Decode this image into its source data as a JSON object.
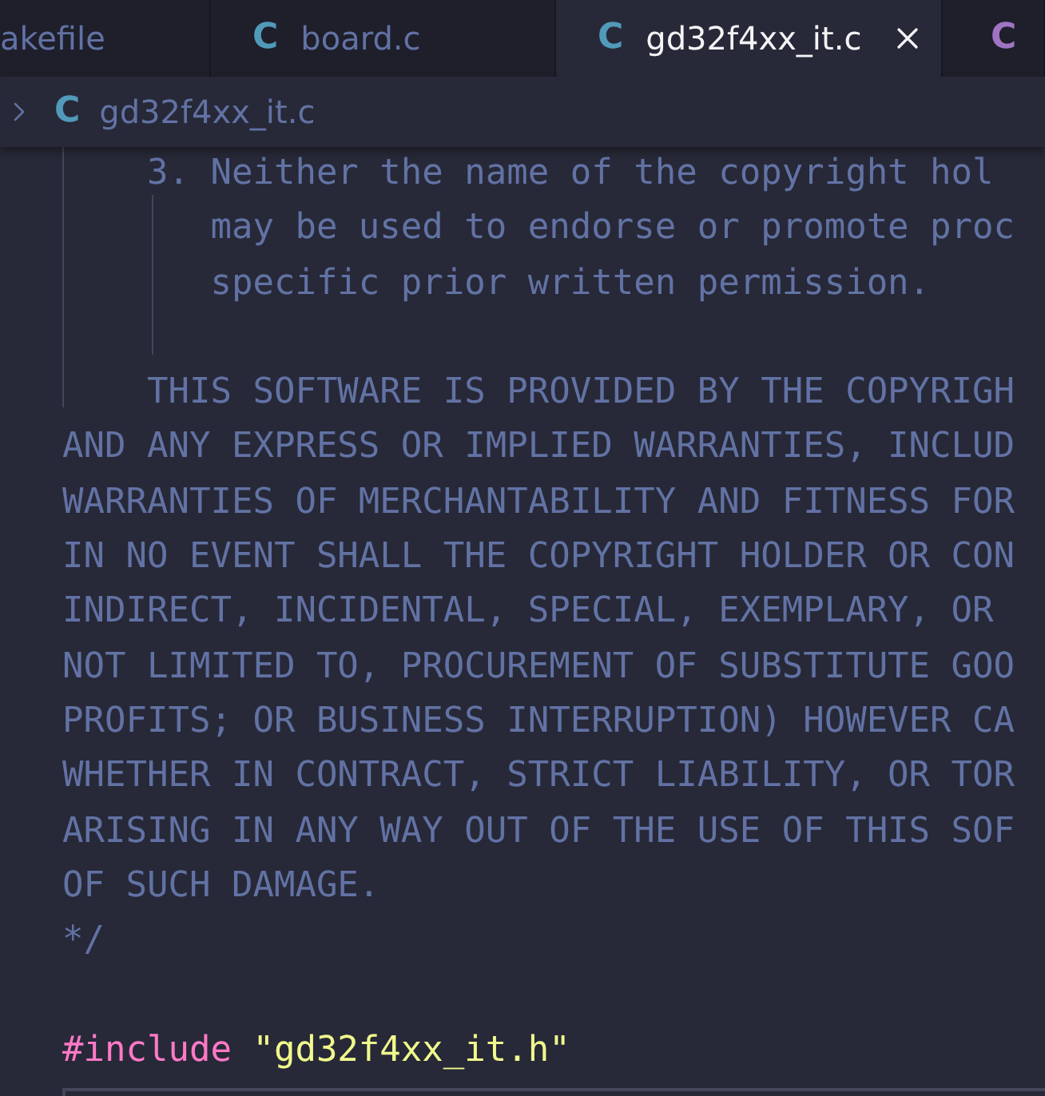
{
  "tabs": [
    {
      "label": "akefile",
      "selected": false
    },
    {
      "icon": "C",
      "color": "#519aba",
      "label": "board.c",
      "selected": false
    },
    {
      "icon": "C",
      "color": "#519aba",
      "label": "gd32f4xx_it.c",
      "selected": true
    },
    {
      "icon": "C",
      "color": "#a074c4",
      "selected": false
    }
  ],
  "breadcrumb": {
    "icon": "C",
    "label": "gd32f4xx_it.c"
  },
  "code_lines": [
    {
      "tokens": [
        {
          "kind": "comment",
          "text": "    3. Neither the name of the copyright hol"
        }
      ]
    },
    {
      "tokens": [
        {
          "kind": "comment",
          "text": "       may be used to endorse or promote proc"
        }
      ]
    },
    {
      "tokens": [
        {
          "kind": "comment",
          "text": "       specific prior written permission."
        }
      ]
    },
    {
      "space_before": true,
      "tokens": [
        {
          "kind": "comment",
          "text": "    THIS SOFTWARE IS PROVIDED BY THE COPYRIGH"
        }
      ]
    },
    {
      "tokens": [
        {
          "kind": "comment",
          "text": "AND ANY EXPRESS OR IMPLIED WARRANTIES, INCLUD"
        }
      ]
    },
    {
      "tokens": [
        {
          "kind": "comment",
          "text": "WARRANTIES OF MERCHANTABILITY AND FITNESS FOR"
        }
      ]
    },
    {
      "tokens": [
        {
          "kind": "comment",
          "text": "IN NO EVENT SHALL THE COPYRIGHT HOLDER OR CON"
        }
      ]
    },
    {
      "tokens": [
        {
          "kind": "comment",
          "text": "INDIRECT, INCIDENTAL, SPECIAL, EXEMPLARY, OR"
        }
      ]
    },
    {
      "tokens": [
        {
          "kind": "comment",
          "text": "NOT LIMITED TO, PROCUREMENT OF SUBSTITUTE GOO"
        }
      ]
    },
    {
      "tokens": [
        {
          "kind": "comment",
          "text": "PROFITS; OR BUSINESS INTERRUPTION) HOWEVER CA"
        }
      ]
    },
    {
      "tokens": [
        {
          "kind": "comment",
          "text": "WHETHER IN CONTRACT, STRICT LIABILITY, OR TOR"
        }
      ]
    },
    {
      "tokens": [
        {
          "kind": "comment",
          "text": "ARISING IN ANY WAY OUT OF THE USE OF THIS SOF"
        }
      ]
    },
    {
      "tokens": [
        {
          "kind": "comment",
          "text": "OF SUCH DAMAGE."
        }
      ]
    },
    {
      "tokens": [
        {
          "kind": "comment",
          "text": "*/"
        }
      ]
    },
    {
      "space_before": true,
      "tokens": [
        {
          "kind": "keyword",
          "text": "#include"
        },
        {
          "kind": "string",
          "text": "\"gd32f4xx_it.h\""
        }
      ]
    }
  ]
}
